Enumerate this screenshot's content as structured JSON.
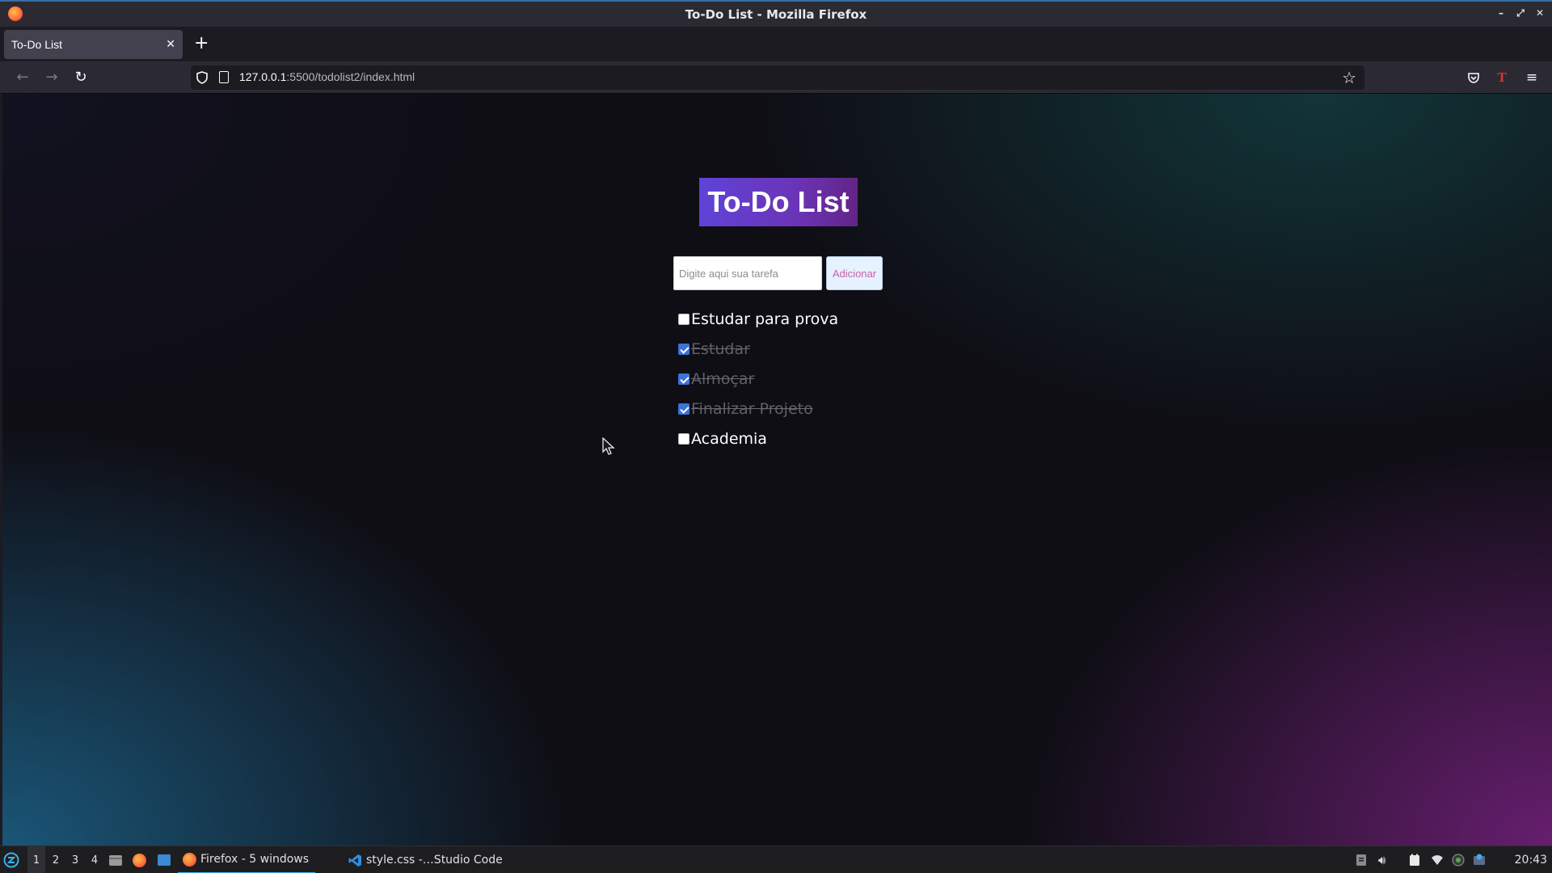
{
  "window": {
    "title": "To-Do List - Mozilla Firefox"
  },
  "tabs": [
    {
      "label": "To-Do List",
      "active": true
    }
  ],
  "navbar": {
    "url_host": "127.0.0.1",
    "url_path": ":5500/todolist2/index.html"
  },
  "page": {
    "heading": "To-Do List",
    "input_placeholder": "Digite aqui sua tarefa",
    "add_label": "Adicionar",
    "tasks": [
      {
        "label": "Estudar para prova",
        "done": false
      },
      {
        "label": "Estudar",
        "done": true
      },
      {
        "label": "Almoçar",
        "done": true
      },
      {
        "label": "Finalizar Projeto",
        "done": true
      },
      {
        "label": "Academia",
        "done": false
      }
    ]
  },
  "taskbar": {
    "workspaces": [
      "1",
      "2",
      "3",
      "4"
    ],
    "active_workspace": "1",
    "apps": [
      {
        "label": "Firefox - 5 windows",
        "icon": "firefox-icon",
        "active": true
      },
      {
        "label": "style.css -…Studio Code",
        "icon": "vscode-icon",
        "active": false
      }
    ],
    "clock": "20:43"
  },
  "colors": {
    "accent": "#5f43d8",
    "accent_end": "#632487",
    "checkbox_checked": "#3b73d9",
    "taskbar_active": "#3daee9"
  }
}
